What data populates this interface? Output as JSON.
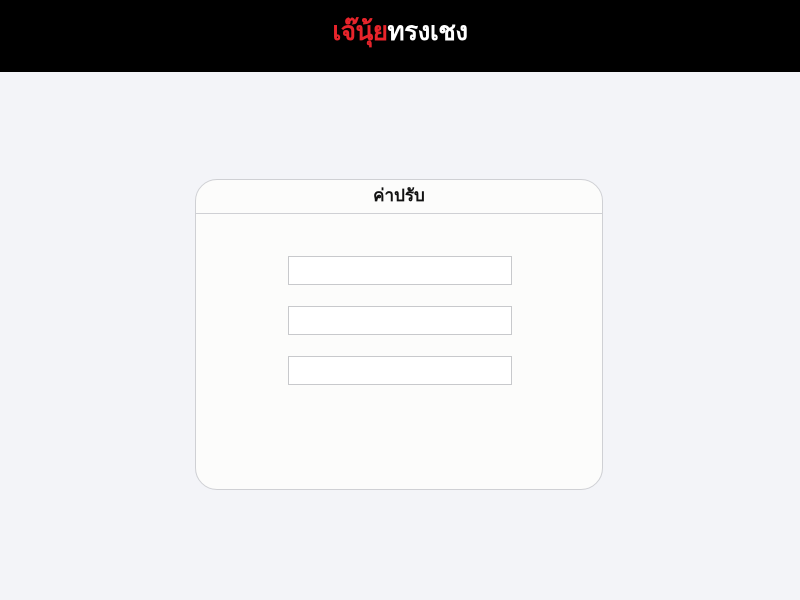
{
  "header": {
    "logo_part_a": "เจ๊นุ้ย",
    "logo_part_b": "ทรงเชง",
    "colors": {
      "background": "#000000",
      "logo_accent": "#e8242b",
      "logo_text": "#ffffff"
    }
  },
  "card": {
    "title": "ค่าปรับ",
    "fields": [
      {
        "value": "",
        "placeholder": ""
      },
      {
        "value": "",
        "placeholder": ""
      },
      {
        "value": "",
        "placeholder": ""
      }
    ]
  },
  "page": {
    "background_color": "#f3f4f8"
  }
}
